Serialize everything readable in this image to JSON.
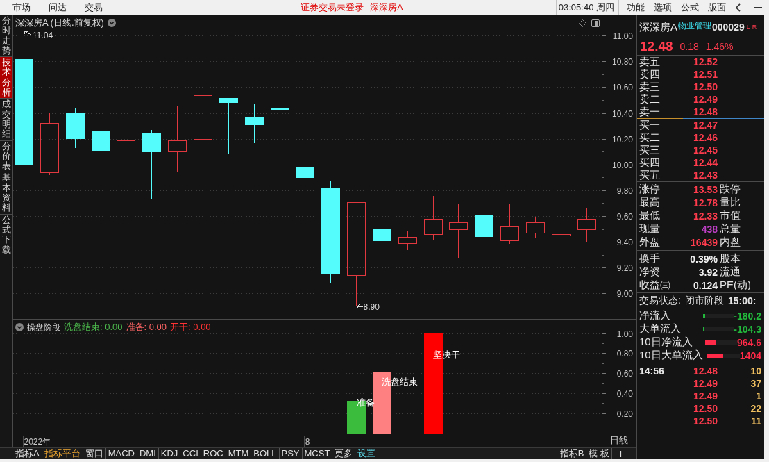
{
  "top_bar": {
    "menu": [
      "市场",
      "问达",
      "交易"
    ],
    "notice": "证券交易未登录",
    "stock": "深深房A",
    "clock": "03:05:40 周四",
    "actions": [
      "功能",
      "选项",
      "公式",
      "版面"
    ]
  },
  "sidebar": {
    "tabs": [
      {
        "label": "分时走势",
        "selected": false
      },
      {
        "label": "技术分析",
        "selected": true
      },
      {
        "label": "成交明细",
        "selected": false
      },
      {
        "label": "分价表",
        "selected": false
      },
      {
        "label": "基本资料",
        "selected": false
      },
      {
        "label": "公式下载",
        "selected": false
      }
    ]
  },
  "price_chart": {
    "title": "深深房A (日线.前复权)",
    "chart_data": [
      {
        "type": "candlestick",
        "ohlc": [
          [
            10.82,
            11.04,
            9.89,
            10.0
          ],
          [
            9.94,
            10.4,
            9.92,
            10.32
          ],
          [
            10.4,
            10.44,
            10.13,
            10.2
          ],
          [
            10.26,
            10.27,
            10.0,
            10.11
          ],
          [
            10.18,
            10.26,
            9.99,
            10.19
          ],
          [
            10.25,
            10.27,
            9.73,
            10.1
          ],
          [
            10.1,
            10.46,
            9.95,
            10.19
          ],
          [
            10.2,
            10.6,
            10.01,
            10.54
          ],
          [
            10.52,
            10.52,
            10.08,
            10.48
          ],
          [
            10.37,
            10.47,
            10.17,
            10.31
          ],
          [
            10.44,
            10.64,
            10.2,
            10.43
          ],
          [
            9.98,
            10.1,
            9.69,
            9.9
          ],
          [
            9.82,
            9.87,
            9.08,
            9.15
          ],
          [
            9.14,
            9.71,
            8.9,
            9.71
          ],
          [
            9.5,
            9.55,
            9.27,
            9.41
          ],
          [
            9.39,
            9.49,
            9.34,
            9.44
          ],
          [
            9.46,
            9.76,
            9.42,
            9.58
          ],
          [
            9.5,
            9.7,
            9.28,
            9.55
          ],
          [
            9.61,
            9.61,
            9.3,
            9.44
          ],
          [
            9.41,
            9.7,
            9.39,
            9.52
          ],
          [
            9.47,
            9.59,
            9.43,
            9.55
          ],
          [
            9.45,
            9.53,
            9.28,
            9.46
          ],
          [
            9.5,
            9.66,
            9.4,
            9.58
          ]
        ],
        "ylim": [
          8.8,
          11.16
        ],
        "yticks": [
          {
            "value": 9,
            "label": "9.00"
          },
          {
            "value": 9.2,
            "label": "9.20"
          },
          {
            "value": 9.4,
            "label": "9.40"
          },
          {
            "value": 9.6,
            "label": "9.60"
          },
          {
            "value": 9.8,
            "label": "9.80"
          },
          {
            "value": 10,
            "label": "10.00"
          },
          {
            "value": 10.2,
            "label": "10.20"
          },
          {
            "value": 10.4,
            "label": "10.40"
          },
          {
            "value": 10.6,
            "label": "10.60"
          },
          {
            "value": 10.8,
            "label": "10.80"
          },
          {
            "value": 11,
            "label": "11.00"
          }
        ],
        "grid": true,
        "annotations": [
          "11.04",
          "8.90"
        ]
      }
    ]
  },
  "indicator_chart": {
    "title": "操盘阶段",
    "legend": [
      {
        "text": "洗盘结束: 0.00",
        "color": "#4cb84c"
      },
      {
        "text": "准备: 0.00",
        "color": "#ff6464"
      },
      {
        "text": "开干: 0.00",
        "color": "#ff3333"
      }
    ],
    "chart_data": [
      {
        "type": "bar",
        "categories": [
          "2022年",
          null,
          null,
          null,
          null,
          null,
          null,
          null,
          null,
          null,
          null,
          "8",
          null,
          null,
          null,
          null,
          null,
          null,
          null,
          null,
          null,
          null,
          null
        ],
        "values": [
          null,
          null,
          null,
          null,
          null,
          null,
          null,
          null,
          null,
          null,
          null,
          null,
          null,
          0.33,
          0.62,
          null,
          1.0,
          null,
          null,
          null,
          null,
          null,
          null
        ],
        "colors": [
          null,
          null,
          null,
          null,
          null,
          null,
          null,
          null,
          null,
          null,
          null,
          null,
          null,
          "#3cbc3c",
          "#ff8080",
          null,
          "#ff0000",
          null,
          null,
          null,
          null,
          null,
          null
        ],
        "ylim": [
          -0.02,
          1.14
        ],
        "yticks": [
          {
            "value": 0.2,
            "label": "0.20"
          },
          {
            "value": 0.4,
            "label": "0.40"
          },
          {
            "value": 0.6,
            "label": "0.60"
          },
          {
            "value": 0.8,
            "label": "0.80"
          },
          {
            "value": 1,
            "label": "1.00"
          }
        ],
        "grid": true,
        "annotations": [
          "准备",
          "洗盘结束",
          "坚决干"
        ]
      }
    ],
    "period_label": "日线"
  },
  "quote": {
    "name": "深深房A",
    "industry": "物业管理",
    "code": "000029",
    "flags": [
      "L",
      "R"
    ],
    "price": "12.48",
    "change": "0.18",
    "change_pct": "1.46%",
    "asks": [
      {
        "label": "卖五",
        "price": "12.52"
      },
      {
        "label": "卖四",
        "price": "12.51"
      },
      {
        "label": "卖三",
        "price": "12.50"
      },
      {
        "label": "卖二",
        "price": "12.49"
      },
      {
        "label": "卖一",
        "price": "12.48"
      }
    ],
    "bids": [
      {
        "label": "买一",
        "price": "12.47"
      },
      {
        "label": "买二",
        "price": "12.46"
      },
      {
        "label": "买三",
        "price": "12.45"
      },
      {
        "label": "买四",
        "price": "12.44"
      },
      {
        "label": "买五",
        "price": "12.43"
      }
    ],
    "stats": [
      {
        "label": "涨停",
        "value": "13.53",
        "color": "#ff3b4e",
        "label2": "跌停"
      },
      {
        "label": "最高",
        "value": "12.78",
        "color": "#ff3b4e",
        "label2": "量比"
      },
      {
        "label": "最低",
        "value": "12.33",
        "color": "#ff3b4e",
        "label2": "市值"
      },
      {
        "label": "现量",
        "value": "438",
        "color": "#c040c8",
        "label2": "总量"
      },
      {
        "label": "外盘",
        "value": "16439",
        "color": "#ff3b4e",
        "label2": "内盘"
      }
    ],
    "fundamentals": [
      {
        "label": "换手",
        "value": "0.39%",
        "label2": "股本"
      },
      {
        "label": "净资",
        "value": "3.92",
        "label2": "流通"
      },
      {
        "label": "收益㈢",
        "value": "0.124",
        "label2": "PE(动)"
      }
    ],
    "status": {
      "label": "交易状态:",
      "value": "闭市阶段",
      "time": "15:00:"
    },
    "flows": [
      {
        "label": "净流入",
        "value": "-180.2",
        "color": "#22b83c",
        "level": 0.06
      },
      {
        "label": "大单流入",
        "value": "-104.3",
        "color": "#22b83c",
        "level": 0.035
      },
      {
        "label": "10日净流入",
        "value": "964.6",
        "color": "#ff2a48",
        "level": 0.33
      },
      {
        "label": "10日大单流入",
        "value": "1404",
        "color": "#ff2a48",
        "level": 0.5
      }
    ],
    "ticks": [
      {
        "time": "14:56",
        "price": "12.48",
        "volume": "10"
      },
      {
        "price": "12.49",
        "volume": "37"
      },
      {
        "price": "12.49",
        "volume": "1"
      },
      {
        "price": "12.50",
        "volume": "22"
      },
      {
        "price": "12.50",
        "volume": "11"
      }
    ]
  },
  "bottom_tabs": {
    "left": [
      {
        "label": "指标A",
        "color": "#e0e0e0"
      },
      {
        "label": "指标平台",
        "color": "#f0a830"
      },
      {
        "label": "窗口",
        "color": "#e0e0e0"
      },
      {
        "label": "MACD",
        "color": "#e0e0e0"
      },
      {
        "label": "DMI",
        "color": "#e0e0e0"
      },
      {
        "label": "KDJ",
        "color": "#e0e0e0"
      },
      {
        "label": "CCI",
        "color": "#e0e0e0"
      },
      {
        "label": "ROC",
        "color": "#e0e0e0"
      },
      {
        "label": "MTM",
        "color": "#e0e0e0"
      },
      {
        "label": "BOLL",
        "color": "#e0e0e0"
      },
      {
        "label": "PSY",
        "color": "#e0e0e0"
      },
      {
        "label": "MCST",
        "color": "#e0e0e0"
      },
      {
        "label": "更多",
        "color": "#e0e0e0"
      },
      {
        "label": "设置",
        "color": "#5cd8e8"
      }
    ],
    "right": [
      {
        "label": "指标B"
      },
      {
        "label": "模 板"
      }
    ]
  }
}
